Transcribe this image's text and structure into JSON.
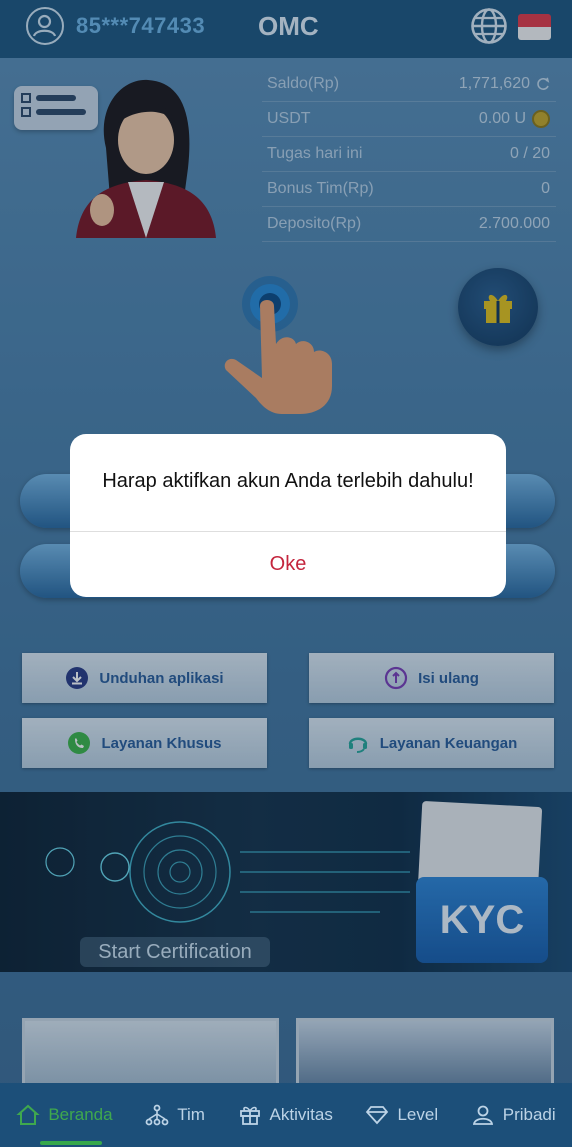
{
  "header": {
    "phone": "85***747433",
    "brand": "OMC"
  },
  "stats": [
    {
      "label": "Saldo(Rp)",
      "value": "1,771,620"
    },
    {
      "label": "USDT",
      "value": "0.00 U"
    },
    {
      "label": "Tugas hari ini",
      "value": "0 / 20"
    },
    {
      "label": "Bonus Tim(Rp)",
      "value": "0"
    },
    {
      "label": "Deposito(Rp)",
      "value": "2.700.000"
    }
  ],
  "actions": {
    "download": "Unduhan aplikasi",
    "recharge": "Isi ulang",
    "special_service": "Layanan Khusus",
    "finance_service": "Layanan Keuangan"
  },
  "banner": {
    "cert_button": "Start Certification",
    "kyc": "KYC"
  },
  "dialog": {
    "message": "Harap aktifkan akun Anda terlebih dahulu!",
    "ok": "Oke"
  },
  "nav": [
    {
      "label": "Beranda",
      "icon": "home-icon",
      "active": true
    },
    {
      "label": "Tim",
      "icon": "team-icon",
      "active": false
    },
    {
      "label": "Aktivitas",
      "icon": "gift-icon",
      "active": false
    },
    {
      "label": "Level",
      "icon": "diamond-icon",
      "active": false
    },
    {
      "label": "Pribadi",
      "icon": "user-icon",
      "active": false
    }
  ],
  "colors": {
    "accent_active": "#3fa84e",
    "ok_text": "#c4253d",
    "header_bg": "#1f5880"
  }
}
